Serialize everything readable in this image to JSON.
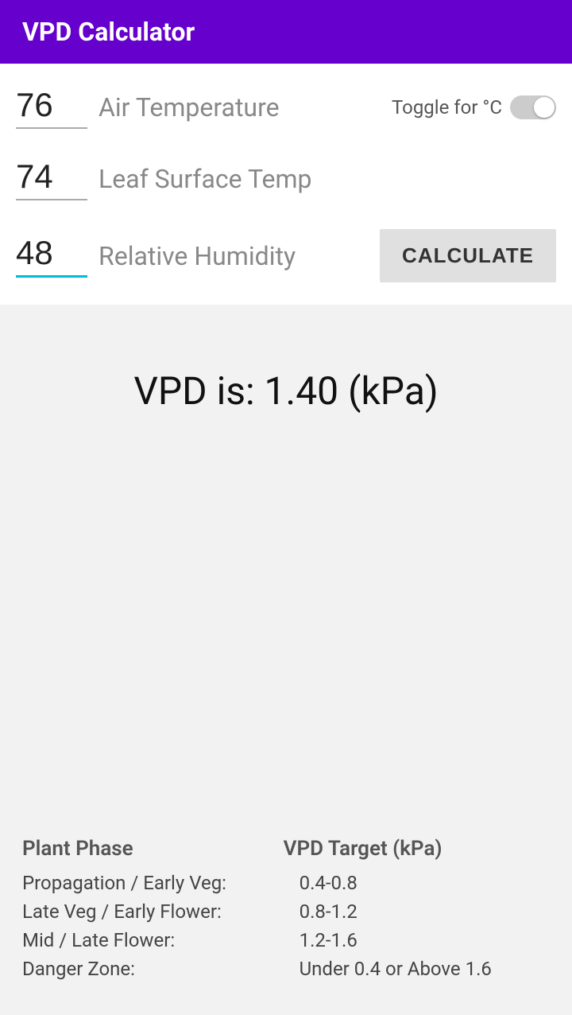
{
  "header": {
    "title": "VPD Calculator",
    "bg_color": "#6600cc"
  },
  "inputs": {
    "air_temp": {
      "value": "76",
      "label": "Air Temperature"
    },
    "leaf_temp": {
      "value": "74",
      "label": "Leaf Surface Temp"
    },
    "humidity": {
      "value": "48",
      "label": "Relative Humidity"
    }
  },
  "toggle": {
    "label": "Toggle for °C"
  },
  "calculate_btn": {
    "label": "CALCULATE"
  },
  "result": {
    "text": "VPD is: 1.40 (kPa)"
  },
  "reference": {
    "col1_header": "Plant Phase",
    "col2_header": "VPD Target (kPa)",
    "rows": [
      {
        "phase": "Propagation / Early Veg:",
        "target": "0.4-0.8"
      },
      {
        "phase": "Late Veg / Early Flower:",
        "target": "0.8-1.2"
      },
      {
        "phase": "Mid / Late Flower:",
        "target": "1.2-1.6"
      },
      {
        "phase": "Danger Zone:",
        "target": "Under 0.4 or Above 1.6"
      }
    ]
  }
}
